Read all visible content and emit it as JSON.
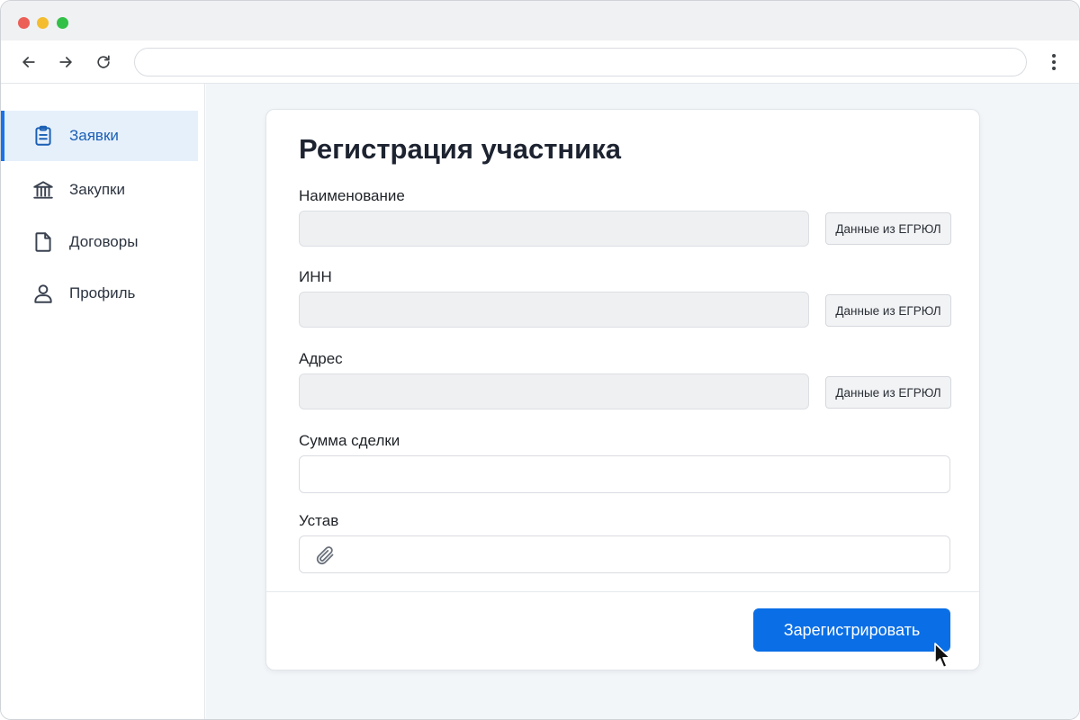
{
  "browser": {
    "address_value": "",
    "icons": {
      "back": "arrow-left-icon",
      "forward": "arrow-right-icon",
      "reload": "reload-icon",
      "menu": "kebab-menu-icon"
    },
    "colors": {
      "close": "#ec5f57",
      "minimize": "#f3bd2f",
      "maximize": "#33c047"
    }
  },
  "sidebar": {
    "active_color": "#1a73e8",
    "items": [
      {
        "label": "Заявки",
        "icon": "clipboard-icon",
        "active": true
      },
      {
        "label": "Закупки",
        "icon": "bank-icon",
        "active": false
      },
      {
        "label": "Договоры",
        "icon": "document-icon",
        "active": false
      },
      {
        "label": "Профиль",
        "icon": "user-icon",
        "active": false
      }
    ]
  },
  "form": {
    "title": "Регистрация участника",
    "fields": [
      {
        "label": "Наименование",
        "value": "",
        "readonly": true,
        "action": "Данные из ЕГРЮЛ"
      },
      {
        "label": "ИНН",
        "value": "",
        "readonly": true,
        "action": "Данные из ЕГРЮЛ"
      },
      {
        "label": "Адрес",
        "value": "",
        "readonly": true,
        "action": "Данные из ЕГРЮЛ"
      },
      {
        "label": "Сумма сделки",
        "value": "",
        "readonly": false
      },
      {
        "label": "Устав",
        "value": "",
        "type": "file",
        "icon": "paperclip-icon"
      }
    ],
    "submit_label": "Зарегистрировать",
    "primary_color": "#0a6ee6"
  }
}
